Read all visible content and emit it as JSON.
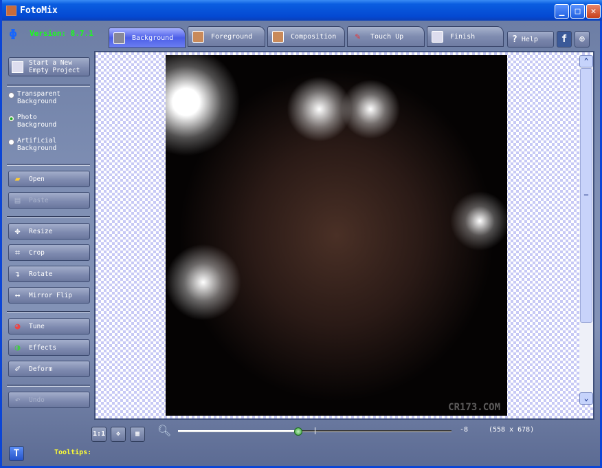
{
  "window": {
    "title": "FotoMix",
    "min": "_",
    "max": "□",
    "close": "✕"
  },
  "version": "Version: 8.7.1",
  "tabs": [
    {
      "label": "Background"
    },
    {
      "label": "Foreground"
    },
    {
      "label": "Composition"
    },
    {
      "label": "Touch Up"
    },
    {
      "label": "Finish"
    }
  ],
  "help": "Help",
  "sidebar": {
    "new_project": [
      "Start a New",
      "Empty Project"
    ],
    "radios": [
      {
        "label": [
          "Transparent",
          "Background"
        ],
        "checked": false
      },
      {
        "label": [
          "Photo",
          "Background"
        ],
        "checked": true
      },
      {
        "label": [
          "Artificial",
          "Background"
        ],
        "checked": false
      }
    ],
    "buttons": {
      "open": "Open",
      "paste": "Paste",
      "resize": "Resize",
      "crop": "Crop",
      "rotate": "Rotate",
      "mirror": "Mirror Flip",
      "tune": "Tune",
      "effects": "Effects",
      "deform": "Deform",
      "undo": "Undo"
    }
  },
  "bottom": {
    "zoom_value": "-8",
    "image_size": "(558 x 678)",
    "tooltips": "Tooltips:",
    "fit_label": "1:1",
    "zoom_slider_percent": 44
  },
  "watermark": "CR173.COM"
}
